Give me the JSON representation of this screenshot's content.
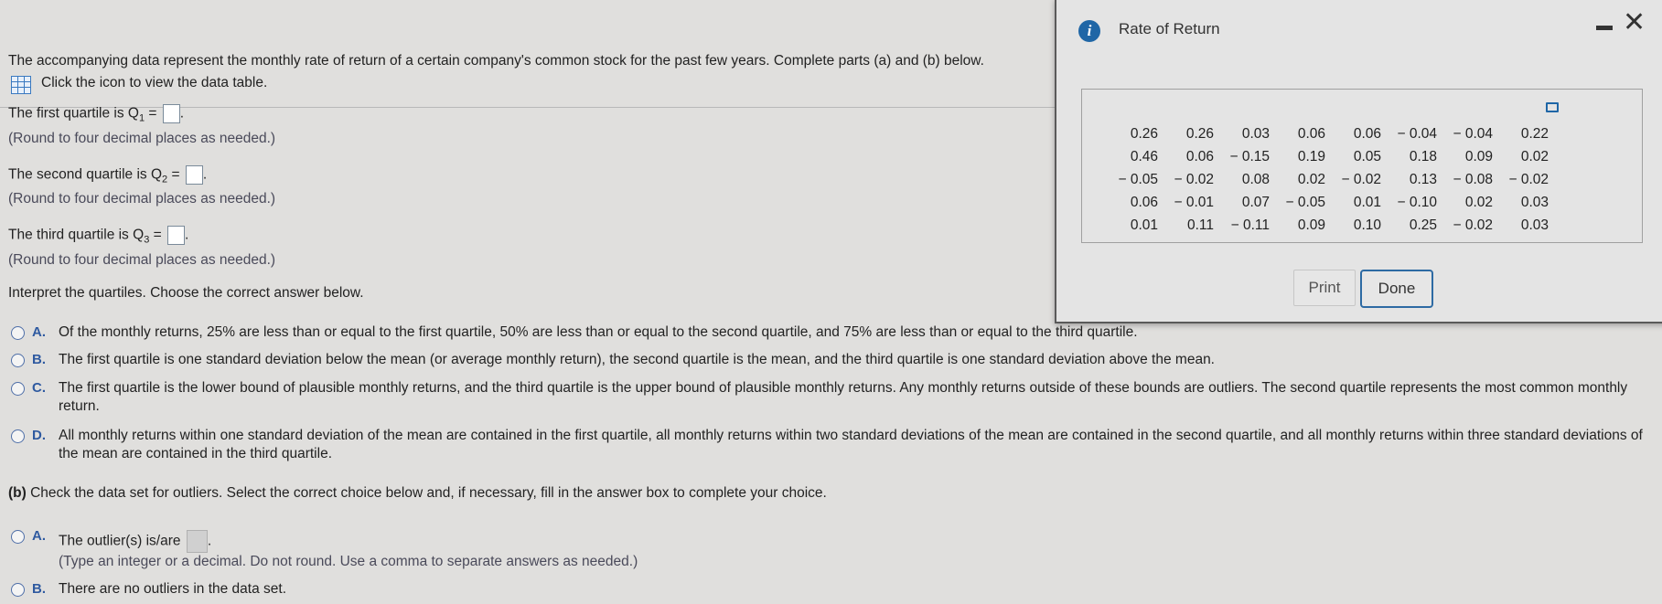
{
  "problem": {
    "intro": "The accompanying data represent the monthly rate of return of a certain company's common stock for the past few years. Complete parts (a) and (b) below.",
    "icon_link": "Click the icon to view the data table.",
    "q1_label": "The first quartile is Q",
    "q1_sub": "1",
    "q2_label": "The second quartile is Q",
    "q2_sub": "2",
    "q3_label": "The third quartile is Q",
    "q3_sub": "3",
    "equals": " = ",
    "round_note": "(Round to four decimal places as needed.)",
    "interpret_prompt": "Interpret the quartiles. Choose the correct answer below.",
    "interpret_options": [
      {
        "letter": "A.",
        "text": "Of the monthly returns, 25% are less than or equal to the first quartile, 50% are less than or equal to the second quartile, and 75% are less than or equal to the third quartile."
      },
      {
        "letter": "B.",
        "text": "The first quartile is one standard deviation below the mean (or average monthly return), the second quartile is the mean, and the third quartile is one standard deviation above the mean."
      },
      {
        "letter": "C.",
        "text": "The first quartile is the lower bound of plausible monthly returns, and the third quartile is the upper bound of plausible monthly returns. Any monthly returns outside of these bounds are outliers. The second quartile represents the most common monthly return."
      },
      {
        "letter": "D.",
        "text": "All monthly returns within one standard deviation of the mean are contained in the first quartile, all monthly returns within two standard deviations of the mean are contained in the second quartile, and all monthly returns within three standard deviations of the mean are contained in the third quartile."
      }
    ],
    "part_b_label": "(b)",
    "part_b_text": " Check the data set for outliers. Select the correct choice below and, if necessary, fill in the answer box to complete your choice.",
    "outlier_options": [
      {
        "letter": "A.",
        "text": "The outlier(s) is/are",
        "note": "(Type an integer or a decimal. Do not round. Use a comma to separate answers as needed.)"
      },
      {
        "letter": "B.",
        "text": "There are no outliers in the data set."
      }
    ],
    "period": "."
  },
  "dialog": {
    "title": "Rate of Return",
    "print_label": "Print",
    "done_label": "Done",
    "table": [
      [
        "0.26",
        "0.26",
        "0.03",
        "0.06",
        "0.06",
        "− 0.04",
        "− 0.04",
        "0.22"
      ],
      [
        "0.46",
        "0.06",
        "− 0.15",
        "0.19",
        "0.05",
        "0.18",
        "0.09",
        "0.02"
      ],
      [
        "− 0.05",
        "− 0.02",
        "0.08",
        "0.02",
        "− 0.02",
        "0.13",
        "− 0.08",
        "− 0.02"
      ],
      [
        "0.06",
        "− 0.01",
        "0.07",
        "− 0.05",
        "0.01",
        "− 0.10",
        "0.02",
        "0.03"
      ],
      [
        "0.01",
        "0.11",
        "− 0.11",
        "0.09",
        "0.10",
        "0.25",
        "− 0.02",
        "0.03"
      ]
    ]
  },
  "colors": {
    "accent": "#2f5aa0",
    "info": "#1f66a6",
    "background": "#e0dfdd"
  }
}
